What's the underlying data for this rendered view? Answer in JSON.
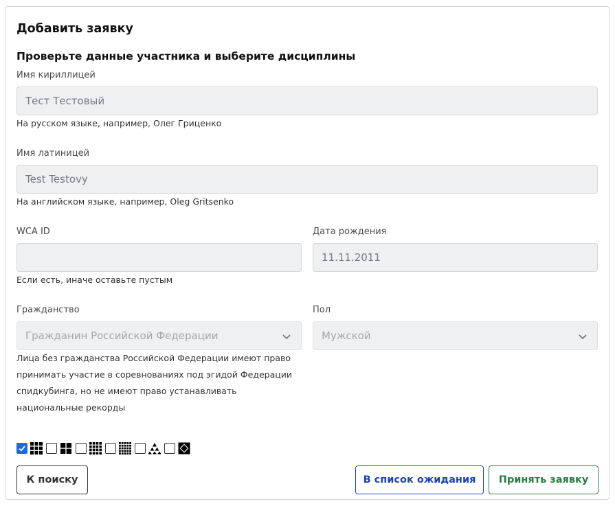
{
  "card": {
    "title": "Добавить заявку",
    "subtitle": "Проверьте данные участника и выберите дисциплины"
  },
  "fields": {
    "name_cyrillic": {
      "label": "Имя кириллицей",
      "value": "Тест Тестовый",
      "help": "На русском языке, например, Олег Гриценко"
    },
    "name_latin": {
      "label": "Имя латиницей",
      "value": "Test Testovy",
      "help": "На английском языке, например, Oleg Gritsenko"
    },
    "wca_id": {
      "label": "WCA ID",
      "value": "",
      "help": "Если есть, иначе оставьте пустым"
    },
    "birth_date": {
      "label": "Дата рождения",
      "value": "11.11.2011"
    },
    "citizenship": {
      "label": "Гражданство",
      "value": "Гражданин Российской Федерации",
      "help_lines": [
        "Лица без гражданства Российской Федерации имеют право",
        "принимать участие в соревнованиях под эгидой Федерации",
        "спидкубинга, но не имеют право устанавливать",
        "национальные рекорды"
      ]
    },
    "gender": {
      "label": "Пол",
      "value": "Мужской"
    }
  },
  "events": [
    {
      "icon": "cube-3x3-icon",
      "checked": true
    },
    {
      "icon": "cube-2x2-icon",
      "checked": false
    },
    {
      "icon": "cube-4x4-icon",
      "checked": false
    },
    {
      "icon": "cube-5x5-icon",
      "checked": false
    },
    {
      "icon": "pyraminx-icon",
      "checked": false
    },
    {
      "icon": "skewb-icon",
      "checked": false
    }
  ],
  "buttons": {
    "back": "К поиску",
    "waitlist": "В список ожидания",
    "accept": "Принять заявку"
  },
  "colors": {
    "checkbox_checked": "#1a6bdd",
    "waitlist_button": "#1d43b8",
    "accept_button": "#2a7d45"
  }
}
